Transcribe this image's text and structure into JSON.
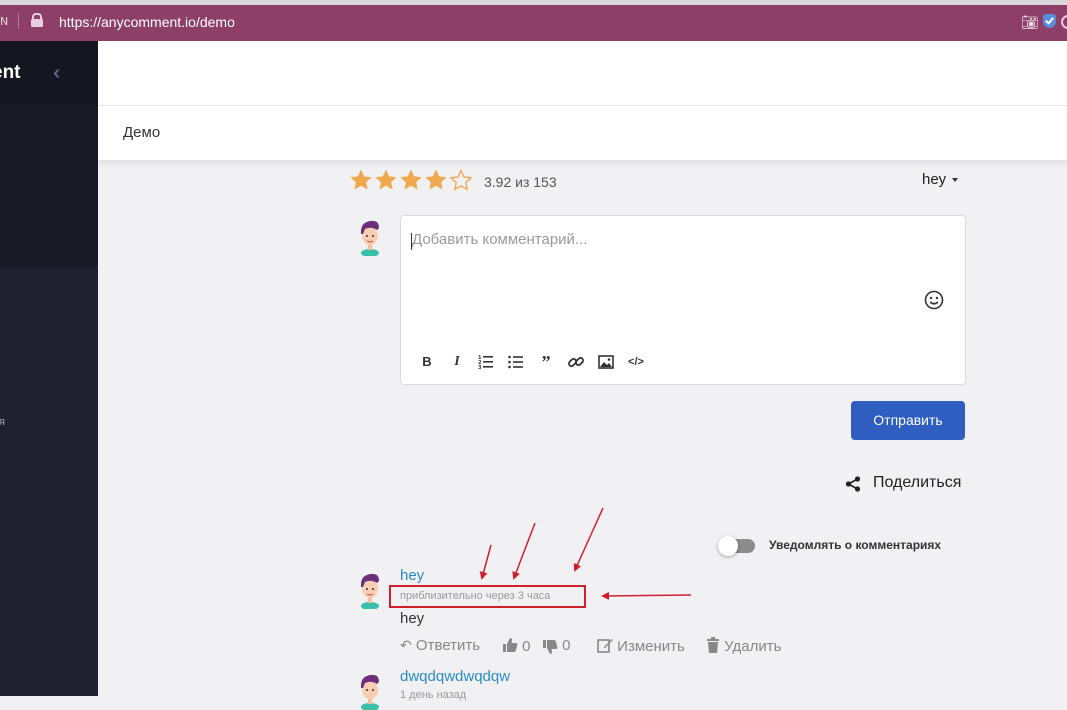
{
  "browser": {
    "url": "https://anycomment.io/demo",
    "left_glyph": "N"
  },
  "sidebar": {
    "brand": "ent",
    "stub_text": "я"
  },
  "breadcrumb": {
    "title": "Демо"
  },
  "rating": {
    "value_text": "3.92 из 153",
    "stars_filled": 4,
    "stars_total": 5,
    "color": "#f0a84e"
  },
  "user_menu": {
    "name": "hey"
  },
  "editor": {
    "placeholder": "Добавить комментарий...",
    "toolbar": [
      "bold-icon",
      "italic-icon",
      "ordered-list-icon",
      "bullet-list-icon",
      "quote-icon",
      "link-icon",
      "image-icon",
      "code-icon"
    ]
  },
  "send_button": {
    "label": "Отправить",
    "color": "#2f5ec0"
  },
  "share": {
    "label": "Поделиться"
  },
  "notify": {
    "label": "Уведомлять о комментариях",
    "enabled": false
  },
  "comments": [
    {
      "author": "hey",
      "time": "приблизительно через 3 часа",
      "text": "hey",
      "reply_label": "Ответить",
      "likes": "0",
      "dislikes": "0",
      "edit_label": "Изменить",
      "delete_label": "Удалить"
    },
    {
      "author": "dwqdqwdwqdqw",
      "time": "1 день назад"
    }
  ],
  "colors": {
    "browser_bar": "#8e3f67",
    "sidebar": "#1f2130",
    "author_link": "#2a8bc9",
    "annotation": "#d0202e"
  }
}
